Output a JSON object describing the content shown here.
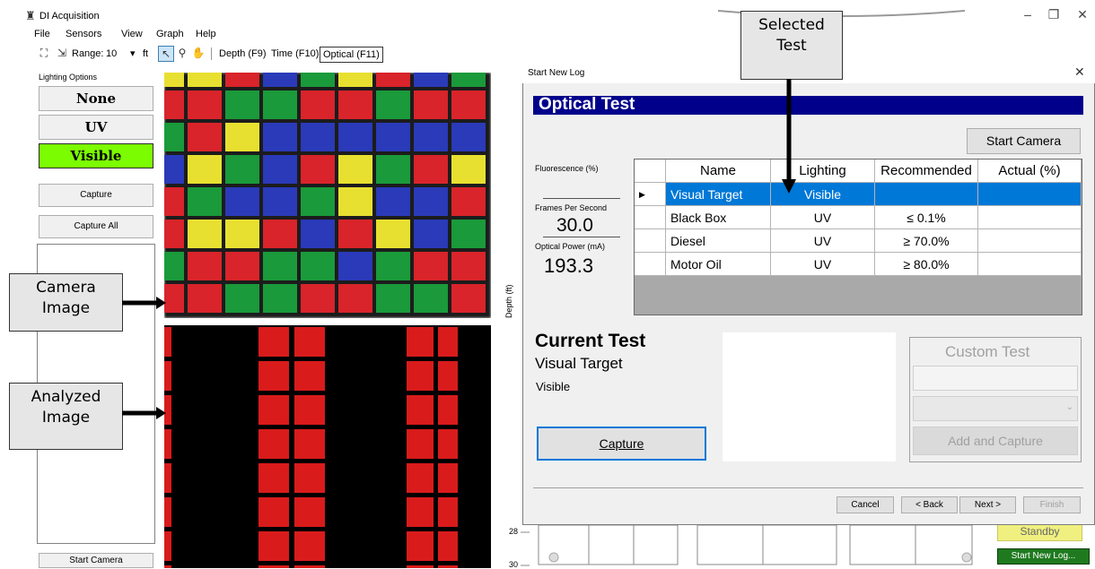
{
  "window": {
    "title": "DI Acquisition",
    "minimize": "–",
    "restore": "❐",
    "close": "✕"
  },
  "menu": [
    "File",
    "Sensors",
    "View",
    "Graph",
    "Help"
  ],
  "toolbar": {
    "range_label": "Range:",
    "range_value": "10",
    "range_unit": "ft",
    "depth_tab": "Depth (F9)",
    "time_tab": "Time (F10)",
    "optical_tab": "Optical (F11)"
  },
  "left_panel": {
    "lighting_label": "Lighting Options",
    "none": "None",
    "uv": "UV",
    "visible": "Visible",
    "capture": "Capture",
    "capture_all": "Capture All",
    "start_camera": "Start Camera",
    "selected_lighting": "Visible",
    "selected_color": "#7cfc00"
  },
  "callouts": {
    "camera": "Camera\nImage",
    "analyzed": "Analyzed\nImage",
    "selected": "Selected\nTest"
  },
  "dialog": {
    "title": "Start New Log",
    "close": "✕",
    "banner": "Optical Test",
    "start_camera": "Start Camera",
    "fluorescence_label": "Fluorescence (%)",
    "fps_label": "Frames Per Second",
    "fps_value": "30.0",
    "power_label": "Optical Power (mA)",
    "power_value": "193.3",
    "depth_label": "Depth (ft)",
    "table": {
      "columns": [
        "Name",
        "Lighting",
        "Recommended",
        "Actual (%)"
      ],
      "rows": [
        {
          "name": "Visual Target",
          "lighting": "Visible",
          "recommended": "",
          "actual": "",
          "selected": true
        },
        {
          "name": "Black Box",
          "lighting": "UV",
          "recommended": "≤ 0.1%",
          "actual": ""
        },
        {
          "name": "Diesel",
          "lighting": "UV",
          "recommended": "≥ 70.0%",
          "actual": ""
        },
        {
          "name": "Motor Oil",
          "lighting": "UV",
          "recommended": "≥ 80.0%",
          "actual": ""
        }
      ]
    },
    "current_test_heading": "Current Test",
    "current_test_name": "Visual Target",
    "current_test_lighting": "Visible",
    "capture": "Capture",
    "custom_test_title": "Custom Test",
    "add_capture": "Add and Capture",
    "cancel": "Cancel",
    "back": "< Back",
    "next": "Next >",
    "finish": "Finish"
  },
  "status": {
    "standby": "Standby",
    "start_new_log": "Start New Log..."
  },
  "depth_axis": {
    "tick1": "28",
    "tick2": "30"
  },
  "colors": {
    "banner": "#00008b",
    "selection": "#0078d7",
    "standby": "#f0f080",
    "start_log": "#1f7a1f"
  }
}
